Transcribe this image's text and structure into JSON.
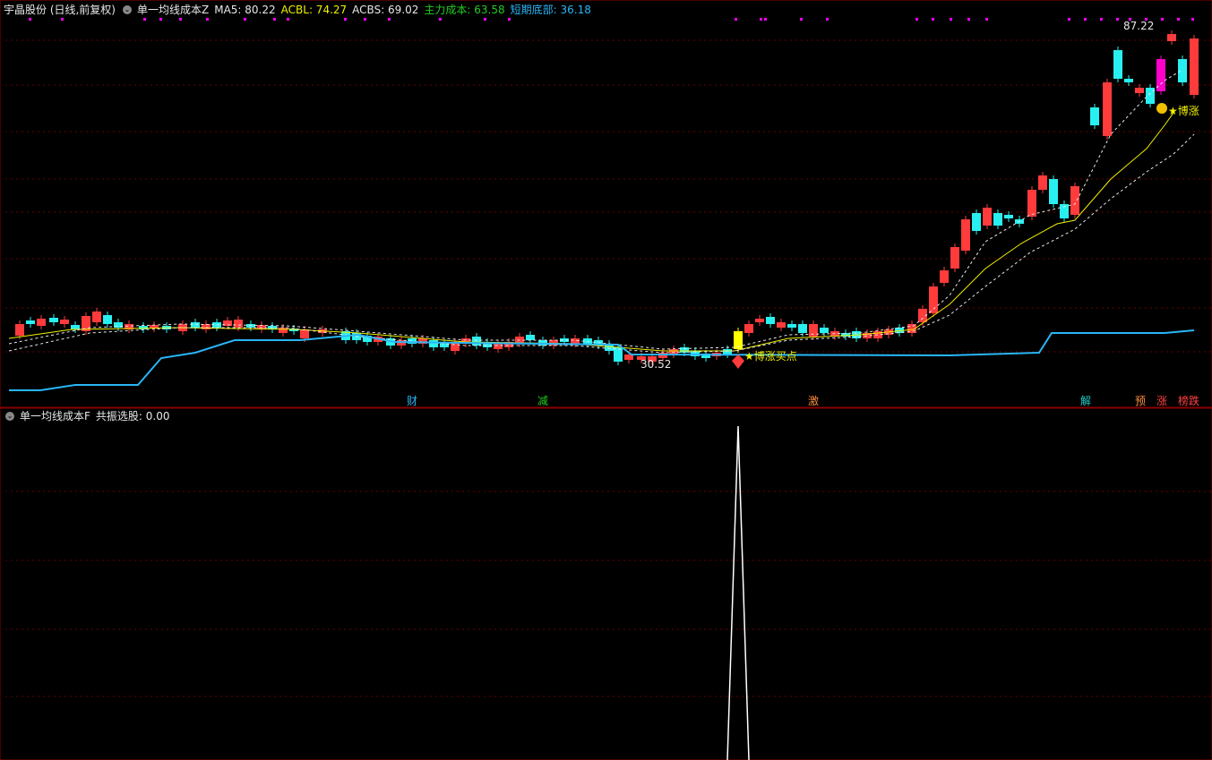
{
  "main": {
    "title": "宇晶股份 (日线,前复权)",
    "indicator_name": "单一均线成本Z",
    "values": [
      {
        "label": "MA5: 80.22",
        "color": "#e8e8e8"
      },
      {
        "label": "ACBL: 74.27",
        "color": "#f0f000"
      },
      {
        "label": "ACBS: 69.02",
        "color": "#e8e8e8"
      },
      {
        "label": "主力成本: 63.58",
        "color": "#22cc22"
      },
      {
        "label": "短期底部: 36.18",
        "color": "#29b6f6"
      }
    ],
    "annotations": {
      "high_price": "87.22",
      "low_price": "30.52",
      "buy_point": "★博涨买点",
      "rise_point": "★博涨"
    },
    "signals": [
      {
        "label": "财",
        "color": "#29b6f6"
      },
      {
        "label": "减",
        "color": "#22cc22"
      },
      {
        "label": "激",
        "color": "#ff8c3a"
      },
      {
        "label": "解",
        "color": "#22cccc"
      },
      {
        "label": "预",
        "color": "#ff8c3a"
      },
      {
        "label": "涨",
        "color": "#ff4040"
      },
      {
        "label": "榜跌",
        "color": "#ff4040"
      }
    ],
    "colors": {
      "up": "#ff3b3b",
      "down": "#29f0f0",
      "bottom_line": "#29b6f6",
      "grid": "#6a0000",
      "magenta": "#ff00ff"
    }
  },
  "sub": {
    "indicator_name": "单一均线成本F",
    "value_label": "共振选股: 0.00"
  }
}
